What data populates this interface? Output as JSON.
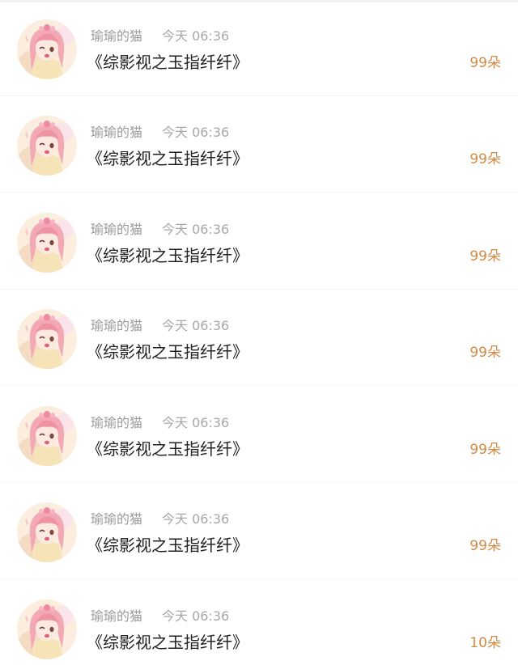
{
  "rows": [
    {
      "username": "瑜瑜的猫",
      "time": "今天 06:36",
      "title": "《综影视之玉指纤纤》",
      "count": "99朵"
    },
    {
      "username": "瑜瑜的猫",
      "time": "今天 06:36",
      "title": "《综影视之玉指纤纤》",
      "count": "99朵"
    },
    {
      "username": "瑜瑜的猫",
      "time": "今天 06:36",
      "title": "《综影视之玉指纤纤》",
      "count": "99朵"
    },
    {
      "username": "瑜瑜的猫",
      "time": "今天 06:36",
      "title": "《综影视之玉指纤纤》",
      "count": "99朵"
    },
    {
      "username": "瑜瑜的猫",
      "time": "今天 06:36",
      "title": "《综影视之玉指纤纤》",
      "count": "99朵"
    },
    {
      "username": "瑜瑜的猫",
      "time": "今天 06:36",
      "title": "《综影视之玉指纤纤》",
      "count": "99朵"
    },
    {
      "username": "瑜瑜的猫",
      "time": "今天 06:36",
      "title": "《综影视之玉指纤纤》",
      "count": "10朵"
    }
  ],
  "colors": {
    "count_accent": "#d18b46",
    "meta_gray": "#9a9a9a",
    "title_dark": "#222222"
  },
  "icons": {
    "avatar": "anime-girl-avatar-icon"
  }
}
